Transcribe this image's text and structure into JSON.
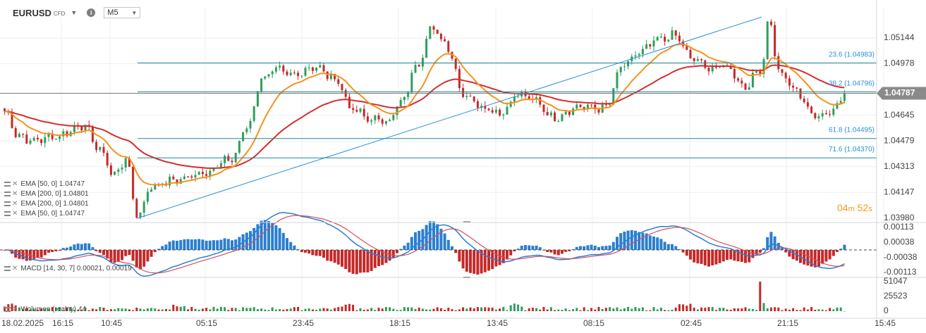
{
  "header": {
    "symbol": "EURUSD",
    "instrument_type": "CFD",
    "timeframe": "M5"
  },
  "indicator_legend": [
    {
      "text": "EMA [50, 0] 1.04747"
    },
    {
      "text": "EMA [200, 0] 1.04801"
    },
    {
      "text": "EMA [200, 0] 1.04801"
    },
    {
      "text": "EMA [50, 0] 1.04747"
    }
  ],
  "macd_legend": "MACD [14, 30, 7] 0.00021, 0.00019",
  "volume_legend": "Wolumen (realny) 44",
  "countdown": {
    "minutes": "04",
    "m": "m",
    "seconds": "52",
    "s": "s"
  },
  "colors": {
    "up_candle": "#2e9e5b",
    "down_candle": "#c62828",
    "ema_fast": "#f5921e",
    "ema_slow": "#d32f2f",
    "fib_lines": "#1a8a9a",
    "trend_line": "#2a8fe0",
    "current_price_tag": "#8a8a8a"
  },
  "chart_data": {
    "type": "candlestick",
    "symbol": "EURUSD",
    "price_axis_ticks": [
      "1.05144",
      "1.04978",
      "1.04645",
      "1.04479",
      "1.04313",
      "1.04147",
      "1.03980"
    ],
    "price_range": [
      1.0398,
      1.0531
    ],
    "time_axis_labels": [
      "18.02.2025",
      "16:15",
      "10:45",
      "05:15",
      "23:45",
      "18:15",
      "13:45",
      "08:15",
      "02:45",
      "21:15",
      "15:45"
    ],
    "current_price": "1.04787",
    "fibonacci_levels": [
      {
        "label": "23.6 (1.04983)",
        "level": 23.6,
        "price": 1.04983
      },
      {
        "label": "38.2 (1.04796)",
        "level": 38.2,
        "price": 1.04796
      },
      {
        "label": "61.8 (1.04495)",
        "level": 61.8,
        "price": 1.04495
      },
      {
        "label": "71.6 (1.04370)",
        "level": 71.6,
        "price": 1.0437
      }
    ],
    "trend_line": {
      "from_price": 1.0398,
      "to_price": 1.0528
    },
    "ema_overlays": [
      {
        "name": "EMA [50, 0]",
        "value": 1.04747
      },
      {
        "name": "EMA [200, 0]",
        "value": 1.04801
      }
    ],
    "macd": {
      "params": [
        14,
        30,
        7
      ],
      "values": [
        0.00021,
        0.00019
      ],
      "axis_ticks": [
        "0.00113",
        "0.00038",
        "-0.00038",
        "-0.00113"
      ],
      "range": [
        -0.00113,
        0.00113
      ]
    },
    "volume": {
      "axis_ticks": [
        "51047",
        "25523",
        "0"
      ],
      "max": 51047,
      "last": 44
    },
    "price_anchors": [
      [
        0,
        1.0467
      ],
      [
        0.015,
        1.0452
      ],
      [
        0.03,
        1.0448
      ],
      [
        0.06,
        1.0451
      ],
      [
        0.09,
        1.0458
      ],
      [
        0.11,
        1.0442
      ],
      [
        0.125,
        1.0426
      ],
      [
        0.14,
        1.0436
      ],
      [
        0.152,
        1.04
      ],
      [
        0.17,
        1.0419
      ],
      [
        0.2,
        1.0423
      ],
      [
        0.23,
        1.0428
      ],
      [
        0.26,
        1.0436
      ],
      [
        0.28,
        1.0458
      ],
      [
        0.295,
        1.0488
      ],
      [
        0.31,
        1.0494
      ],
      [
        0.33,
        1.049
      ],
      [
        0.355,
        1.0496
      ],
      [
        0.38,
        1.0488
      ],
      [
        0.4,
        1.0468
      ],
      [
        0.42,
        1.0462
      ],
      [
        0.44,
        1.0461
      ],
      [
        0.455,
        1.0472
      ],
      [
        0.475,
        1.0498
      ],
      [
        0.49,
        1.0521
      ],
      [
        0.505,
        1.0512
      ],
      [
        0.53,
        1.0477
      ],
      [
        0.55,
        1.047
      ],
      [
        0.57,
        1.0466
      ],
      [
        0.59,
        1.0478
      ],
      [
        0.61,
        1.0474
      ],
      [
        0.63,
        1.0463
      ],
      [
        0.66,
        1.047
      ],
      [
        0.69,
        1.0469
      ],
      [
        0.71,
        1.0496
      ],
      [
        0.73,
        1.0505
      ],
      [
        0.75,
        1.0513
      ],
      [
        0.77,
        1.0516
      ],
      [
        0.79,
        1.0501
      ],
      [
        0.81,
        1.0495
      ],
      [
        0.83,
        1.0496
      ],
      [
        0.85,
        1.0483
      ],
      [
        0.87,
        1.0495
      ],
      [
        0.878,
        1.0527
      ],
      [
        0.89,
        1.0492
      ],
      [
        0.91,
        1.048
      ],
      [
        0.93,
        1.0464
      ],
      [
        0.95,
        1.0467
      ],
      [
        0.965,
        1.0478
      ]
    ]
  }
}
